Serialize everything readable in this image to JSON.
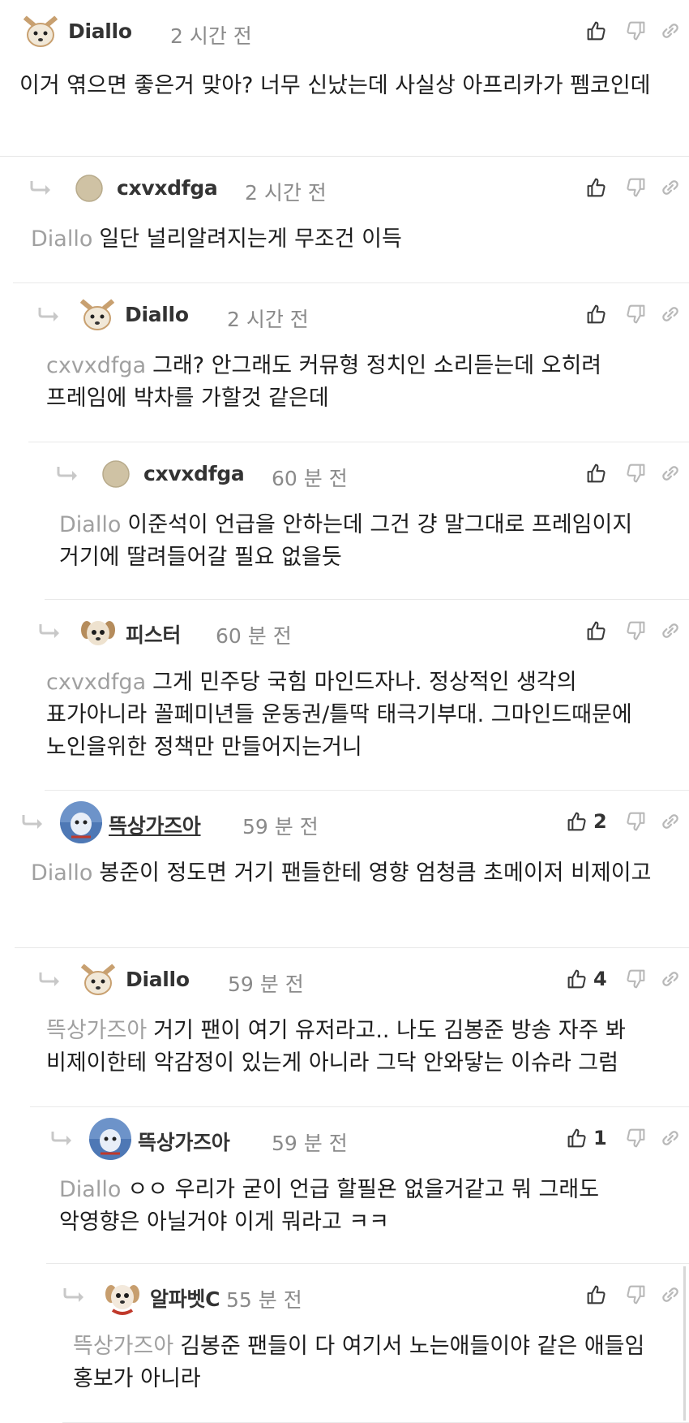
{
  "comments": [
    {
      "author": "Diallo",
      "avatar": "dog-white",
      "time": "2 시간 전",
      "mention": "",
      "text": "이거 엮으면 좋은거 맞아? 너무 신났는데 사실상 아프리카가 펨코인데",
      "likes": ""
    },
    {
      "author": "cxvxdfga",
      "avatar": "beige-circle",
      "time": "2 시간 전",
      "mention": "Diallo",
      "text": "일단 널리알려지는게 무조건 이득",
      "likes": ""
    },
    {
      "author": "Diallo",
      "avatar": "dog-white",
      "time": "2 시간 전",
      "mention": "cxvxdfga",
      "text": "그래? 안그래도 커뮤형 정치인 소리듣는데 오히려 프레임에 박차를 가할것 같은데",
      "likes": ""
    },
    {
      "author": "cxvxdfga",
      "avatar": "beige-circle",
      "time": "60 분 전",
      "mention": "Diallo",
      "text": "이준석이 언급을 안하는데 그건 걍 말그대로 프레임이지 거기에 딸려들어갈 필요 없을듯",
      "likes": ""
    },
    {
      "author": "피스터",
      "avatar": "puppy",
      "time": "60 분 전",
      "mention": "cxvxdfga",
      "text": "그게 민주당 국힘 마인드자나. 정상적인 생각의 표가아니라 꼴페미년들 운동권/틀딱 태극기부대. 그마인드때문에 노인을위한 정책만 만들어지는거니",
      "likes": ""
    },
    {
      "author": "뜩상가즈아",
      "avatar": "blue-photo",
      "time": "59 분 전",
      "mention": "Diallo",
      "text": "봉준이 정도면 거기 팬들한테 영향 엄청큼 초메이저 비제이고",
      "likes": "2"
    },
    {
      "author": "Diallo",
      "avatar": "dog-white",
      "time": "59 분 전",
      "mention": "뜩상가즈아",
      "text": "거기 팬이 여기 유저라고.. 나도 김봉준 방송 자주 봐 비제이한테 악감정이 있는게 아니라 그닥 안와닿는 이슈라 그럼",
      "likes": "4"
    },
    {
      "author": "뜩상가즈아",
      "avatar": "blue-photo",
      "time": "59 분 전",
      "mention": "Diallo",
      "text": "ㅇㅇ 우리가 굳이 언급 할필욘 없을거같고 뭐 그래도 악영향은 아닐거야 이게 뭐라고 ㅋㅋ",
      "likes": "1"
    },
    {
      "author": "알파벳C",
      "avatar": "puppy-red",
      "time": "55 분 전",
      "mention": "뜩상가즈아",
      "text": "김봉준 팬들이 다 여기서 노는애들이야 같은 애들임 홍보가 아니라",
      "likes": ""
    }
  ],
  "icons": {
    "like": "thumbs-up-icon",
    "dislike": "thumbs-down-icon",
    "link": "link-icon",
    "reply": "reply-arrow-icon"
  },
  "colors": {
    "author": "#333333",
    "time": "#8a8a8a",
    "mention": "#a0a0a0",
    "divider": "#e6e6e6"
  }
}
